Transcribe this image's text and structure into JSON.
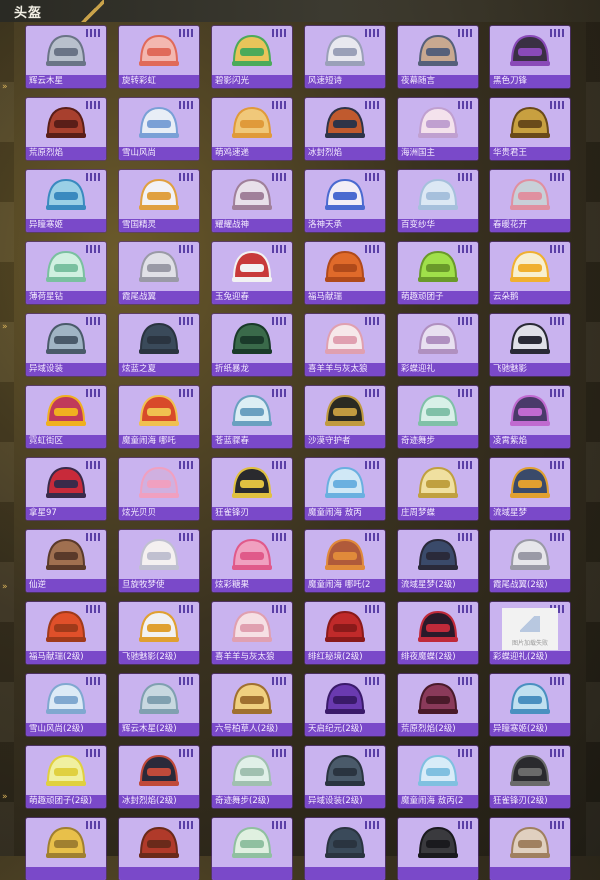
{
  "header": {
    "title": "头盔"
  },
  "items": [
    {
      "label": "辉云木星",
      "color": "#b8c0cc",
      "accent": "#6a7486"
    },
    {
      "label": "旋转彩虹",
      "color": "#f3b7b0",
      "accent": "#e06a5a"
    },
    {
      "label": "碧影闪光",
      "color": "#e9c45a",
      "accent": "#4caa5a"
    },
    {
      "label": "风速短诗",
      "color": "#e8e8ef",
      "accent": "#9aa0b8"
    },
    {
      "label": "夜幕随言",
      "color": "#c8a890",
      "accent": "#56607a"
    },
    {
      "label": "黑色刀锋",
      "color": "#3a3044",
      "accent": "#8a4ab8"
    },
    {
      "label": "荒原烈焰",
      "color": "#a8402e",
      "accent": "#5a1e18"
    },
    {
      "label": "雪山风尚",
      "color": "#e8eef6",
      "accent": "#7aa0d6"
    },
    {
      "label": "萌鸡速递",
      "color": "#f0c87a",
      "accent": "#e09a3a"
    },
    {
      "label": "冰封烈焰",
      "color": "#c05a2e",
      "accent": "#2e3448"
    },
    {
      "label": "海洲国主",
      "color": "#f4e2ec",
      "accent": "#c0a0d0"
    },
    {
      "label": "华贵君王",
      "color": "#c8a040",
      "accent": "#6a4a1a"
    },
    {
      "label": "异瞳寒姬",
      "color": "#9ad0e6",
      "accent": "#3a8abf"
    },
    {
      "label": "雪国精灵",
      "color": "#f2f2f6",
      "accent": "#e0a040"
    },
    {
      "label": "耀耀战神",
      "color": "#e8e0ea",
      "accent": "#a0809a"
    },
    {
      "label": "洛神天承",
      "color": "#f2eef6",
      "accent": "#4a6ad0"
    },
    {
      "label": "百变纱华",
      "color": "#dce8f4",
      "accent": "#a6c0dc"
    },
    {
      "label": "春暖花开",
      "color": "#c8d0d8",
      "accent": "#e090a0"
    },
    {
      "label": "薄荷星钻",
      "color": "#d0f0e0",
      "accent": "#7ac0a0"
    },
    {
      "label": "霞尾战翼",
      "color": "#e0e0e6",
      "accent": "#9a9aa6"
    },
    {
      "label": "玉兔迎春",
      "color": "#c83a3a",
      "accent": "#f2f2f2"
    },
    {
      "label": "福马献瑞",
      "color": "#e06a2a",
      "accent": "#b04a1a"
    },
    {
      "label": "萌趣顽团子",
      "color": "#a0e04a",
      "accent": "#6a9a2a"
    },
    {
      "label": "云朵鹅",
      "color": "#f8f0d0",
      "accent": "#f0b030"
    },
    {
      "label": "异域设装",
      "color": "#a0b4c4",
      "accent": "#4a5a6a"
    },
    {
      "label": "炫蓝之夏",
      "color": "#3a4a5a",
      "accent": "#2a3440"
    },
    {
      "label": "折纸暴龙",
      "color": "#3a6a4a",
      "accent": "#1a3a2a"
    },
    {
      "label": "喜羊羊与灰太狼",
      "color": "#f6e8ea",
      "accent": "#e0a0b0"
    },
    {
      "label": "彩蝶迎礼",
      "color": "#e8e0f0",
      "accent": "#b090c0"
    },
    {
      "label": "飞驰魅影",
      "color": "#e0e0e8",
      "accent": "#2a2a36"
    },
    {
      "label": "霓虹街区",
      "color": "#c03a5a",
      "accent": "#f0b020"
    },
    {
      "label": "魔童闹海 哪吒",
      "color": "#d84a2a",
      "accent": "#f0c050"
    },
    {
      "label": "苍蓝骤春",
      "color": "#dceef4",
      "accent": "#6aa0c0"
    },
    {
      "label": "沙漠守护者",
      "color": "#2a2a22",
      "accent": "#c09a40"
    },
    {
      "label": "奇迹舞步",
      "color": "#d8f0e8",
      "accent": "#80c0a8"
    },
    {
      "label": "凌霄紫焰",
      "color": "#4a3a6a",
      "accent": "#c06ad0"
    },
    {
      "label": "拿星97",
      "color": "#c82a3a",
      "accent": "#3a2a4a"
    },
    {
      "label": "炫光贝贝",
      "color": "#d0b0e0",
      "accent": "#f0a0c0"
    },
    {
      "label": "狂雀锋刃",
      "color": "#2a2a2e",
      "accent": "#e0c040"
    },
    {
      "label": "魔童闹海 敖丙",
      "color": "#d0e8f6",
      "accent": "#6ab0e0"
    },
    {
      "label": "庄周梦蝶",
      "color": "#f0e0a0",
      "accent": "#c0a040"
    },
    {
      "label": "流域星梦",
      "color": "#3a4a6a",
      "accent": "#e0a030"
    },
    {
      "label": "仙逆",
      "color": "#a07050",
      "accent": "#5a3a2a"
    },
    {
      "label": "旦旋牧梦使",
      "color": "#f4f0f0",
      "accent": "#c0c0d0"
    },
    {
      "label": "炫彩糖果",
      "color": "#f0a0c0",
      "accent": "#e05a8a"
    },
    {
      "label": "魔童闹海 哪吒(2",
      "color": "#b05a3a",
      "accent": "#e08a3a"
    },
    {
      "label": "流域星梦(2级)",
      "color": "#3a4a6a",
      "accent": "#2a2a3a"
    },
    {
      "label": "霞尾战翼(2级)",
      "color": "#e6e6ea",
      "accent": "#9a9aa6"
    },
    {
      "label": "福马献瑞(2级)",
      "color": "#e0502a",
      "accent": "#a03a1a"
    },
    {
      "label": "飞驰魅影(2级)",
      "color": "#f2f2f2",
      "accent": "#e0a030"
    },
    {
      "label": "喜羊羊与灰太狼",
      "color": "#f6e0e4",
      "accent": "#e0a0b0"
    },
    {
      "label": "绯红秘境(2级)",
      "color": "#c02a2a",
      "accent": "#8a1a1a"
    },
    {
      "label": "绯夜魔蝶(2级)",
      "color": "#2a1a2a",
      "accent": "#c02a3a"
    },
    {
      "label": "彩蝶迎礼(2级)",
      "color": "#f2f2f2",
      "accent": "#a0b8d8",
      "placeholder": true,
      "placeholder_text": "图片加载失败"
    },
    {
      "label": "雪山风尚(2级)",
      "color": "#dceaf6",
      "accent": "#80a8d0"
    },
    {
      "label": "辉云木星(2级)",
      "color": "#c8d8e0",
      "accent": "#80a0b0"
    },
    {
      "label": "六号柏草人(2级)",
      "color": "#f0d080",
      "accent": "#a07030"
    },
    {
      "label": "天启纪元(2级)",
      "color": "#6a3ab0",
      "accent": "#3a1a6a"
    },
    {
      "label": "荒原烈焰(2级)",
      "color": "#8a3a5a",
      "accent": "#4a1a2a"
    },
    {
      "label": "异瞳寒姬(2级)",
      "color": "#c0e0f0",
      "accent": "#4a90c0"
    },
    {
      "label": "萌趣顽团子(2级)",
      "color": "#f0f0a0",
      "accent": "#e0d040"
    },
    {
      "label": "冰封烈焰(2级)",
      "color": "#2a2a3a",
      "accent": "#c04a3a"
    },
    {
      "label": "奇迹舞步(2级)",
      "color": "#e0f0e8",
      "accent": "#a0c0b0"
    },
    {
      "label": "异域设装(2级)",
      "color": "#4a5a6a",
      "accent": "#2a3440"
    },
    {
      "label": "魔童闹海 敖丙(2",
      "color": "#d8ecf8",
      "accent": "#80c0e0"
    },
    {
      "label": "狂雀锋刃(2级)",
      "color": "#2a2a2e",
      "accent": "#6a6a6a"
    },
    {
      "label": "",
      "color": "#e8c04a",
      "accent": "#a08030"
    },
    {
      "label": "",
      "color": "#b03a2a",
      "accent": "#6a2a1a"
    },
    {
      "label": "",
      "color": "#e0f0e0",
      "accent": "#90c0a0"
    },
    {
      "label": "",
      "color": "#3a4a5a",
      "accent": "#2a3440"
    },
    {
      "label": "",
      "color": "#3a3a3e",
      "accent": "#1a1a1e"
    },
    {
      "label": "",
      "color": "#e0d0c0",
      "accent": "#a08060"
    }
  ]
}
